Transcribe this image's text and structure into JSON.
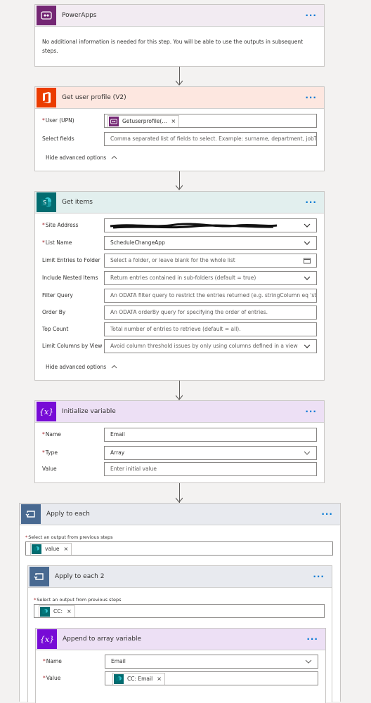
{
  "powerapps": {
    "title": "PowerApps",
    "info": "No additional information is needed for this step. You will be able to use the outputs in subsequent steps."
  },
  "profile": {
    "title": "Get user profile (V2)",
    "user_label": "User (UPN)",
    "user_token": "Getuserprofile(...",
    "select_label": "Select fields",
    "select_placeholder": "Comma separated list of fields to select. Example: surname, department, jobTitl",
    "hide_advanced": "Hide advanced options"
  },
  "get_items": {
    "title": "Get items",
    "site_label": "Site Address",
    "list_label": "List Name",
    "list_value": "ScheduleChangeApp",
    "limit_folder_label": "Limit Entries to Folder",
    "limit_folder_placeholder": "Select a folder, or leave blank for the whole list",
    "nested_label": "Include Nested Items",
    "nested_placeholder": "Return entries contained in sub-folders (default = true)",
    "filter_label": "Filter Query",
    "filter_placeholder": "An ODATA filter query to restrict the entries returned (e.g. stringColumn eq 'stri",
    "order_label": "Order By",
    "order_placeholder": "An ODATA orderBy query for specifying the order of entries.",
    "top_label": "Top Count",
    "top_placeholder": "Total number of entries to retrieve (default = all).",
    "limit_cols_label": "Limit Columns by View",
    "limit_cols_placeholder": "Avoid column threshold issues by only using columns defined in a view",
    "hide_advanced": "Hide advanced options"
  },
  "init_var": {
    "title": "Initialize variable",
    "icon_text": "{x}",
    "name_label": "Name",
    "name_value": "Email",
    "type_label": "Type",
    "type_value": "Array",
    "value_label": "Value",
    "value_placeholder": "Enter initial value"
  },
  "apply_each": {
    "title": "Apply to each",
    "select_label": "Select an output from previous steps",
    "token": "value"
  },
  "apply_each2": {
    "title": "Apply to each 2",
    "select_label": "Select an output from previous steps",
    "token": "CC:"
  },
  "append": {
    "title": "Append to array variable",
    "icon_text": "{x}",
    "name_label": "Name",
    "name_value": "Email",
    "value_label": "Value",
    "value_token": "CC: Email"
  },
  "misc": {
    "required_mark": "*",
    "more_dots": "···",
    "close_x": "×"
  },
  "colors": {
    "powerapps_header": "#f2ebf2",
    "powerapps_icon": "#742774",
    "office_header": "#fde7e0",
    "office_icon": "#eb3c00",
    "sharepoint_header": "#e2efee",
    "sharepoint_icon": "#036c70",
    "variable_header": "#ede0f5",
    "variable_icon": "#770bd6",
    "loop_header": "#e8eaef",
    "loop_icon": "#486991",
    "link": "#0078d4"
  }
}
